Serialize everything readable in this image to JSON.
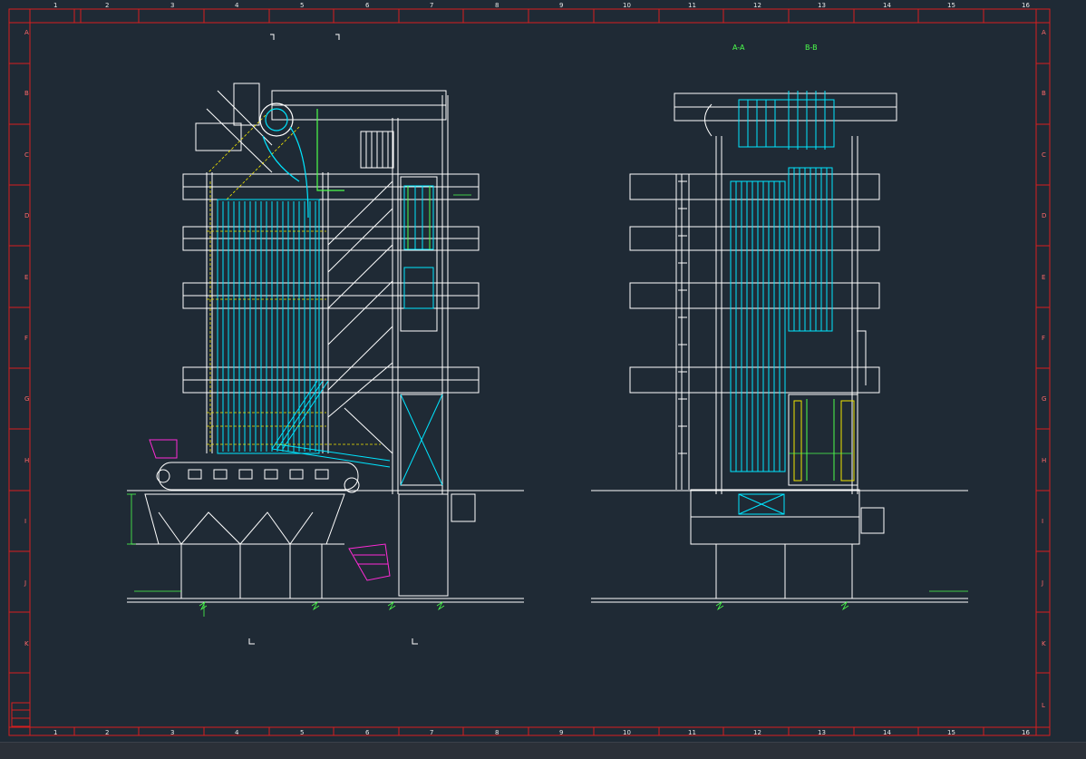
{
  "frame": {
    "column_labels": [
      "1",
      "2",
      "3",
      "4",
      "5",
      "6",
      "7",
      "8",
      "9",
      "10",
      "11",
      "12",
      "13",
      "14",
      "15",
      "16"
    ],
    "row_labels": [
      "A",
      "B",
      "C",
      "D",
      "E",
      "F",
      "G",
      "H",
      "I",
      "J",
      "K",
      "L"
    ]
  },
  "views": {
    "section_a_label": "A-A",
    "section_b_label": "B-B"
  },
  "colors": {
    "background": "#1f2a35",
    "frame": "#d81e1e",
    "structure": "#ffffff",
    "tubes": "#00e5ff",
    "dimension": "#4cff4c",
    "accent_yellow": "#f2e600",
    "accent_magenta": "#ff2bd6"
  },
  "icons": [
    "section-marker-icon",
    "break-symbol-icon"
  ]
}
